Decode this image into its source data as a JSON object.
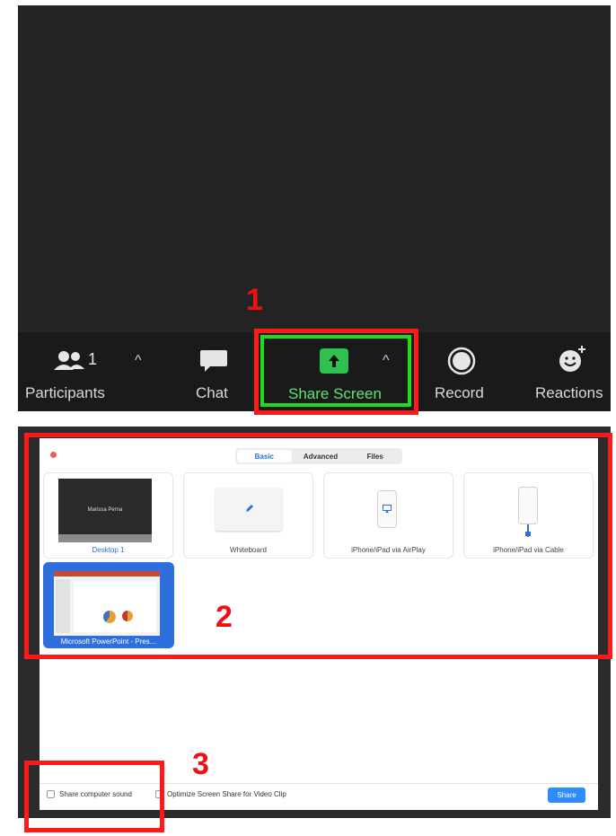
{
  "toolbar": {
    "participants_count": "1",
    "participants_label": "Participants",
    "chat_label": "Chat",
    "share_screen_label": "Share Screen",
    "record_label": "Record",
    "reactions_label": "Reactions",
    "share_screen_highlight_color": "#1fdc1f",
    "share_icon_color": "#2fc14f"
  },
  "annotations": {
    "step1": "1",
    "step2": "2",
    "step3": "3",
    "color": "#ff1a1a"
  },
  "share_dialog": {
    "tabs": [
      "Basic",
      "Advanced",
      "Files"
    ],
    "active_tab": "Basic",
    "tiles": [
      {
        "label": "Desktop 1",
        "thumbnail_text": "Marissa Perna"
      },
      {
        "label": "Whiteboard"
      },
      {
        "label": "iPhone/iPad via AirPlay"
      },
      {
        "label": "iPhone/iPad via Cable"
      },
      {
        "label": "Microsoft PowerPoint - Pres..."
      }
    ],
    "selected_tile": "Microsoft PowerPoint - Pres...",
    "share_computer_sound_label": "Share computer sound",
    "optimize_label": "Optimize Screen Share for Video Clip",
    "share_button_label": "Share",
    "accent_color": "#2d8cff"
  }
}
